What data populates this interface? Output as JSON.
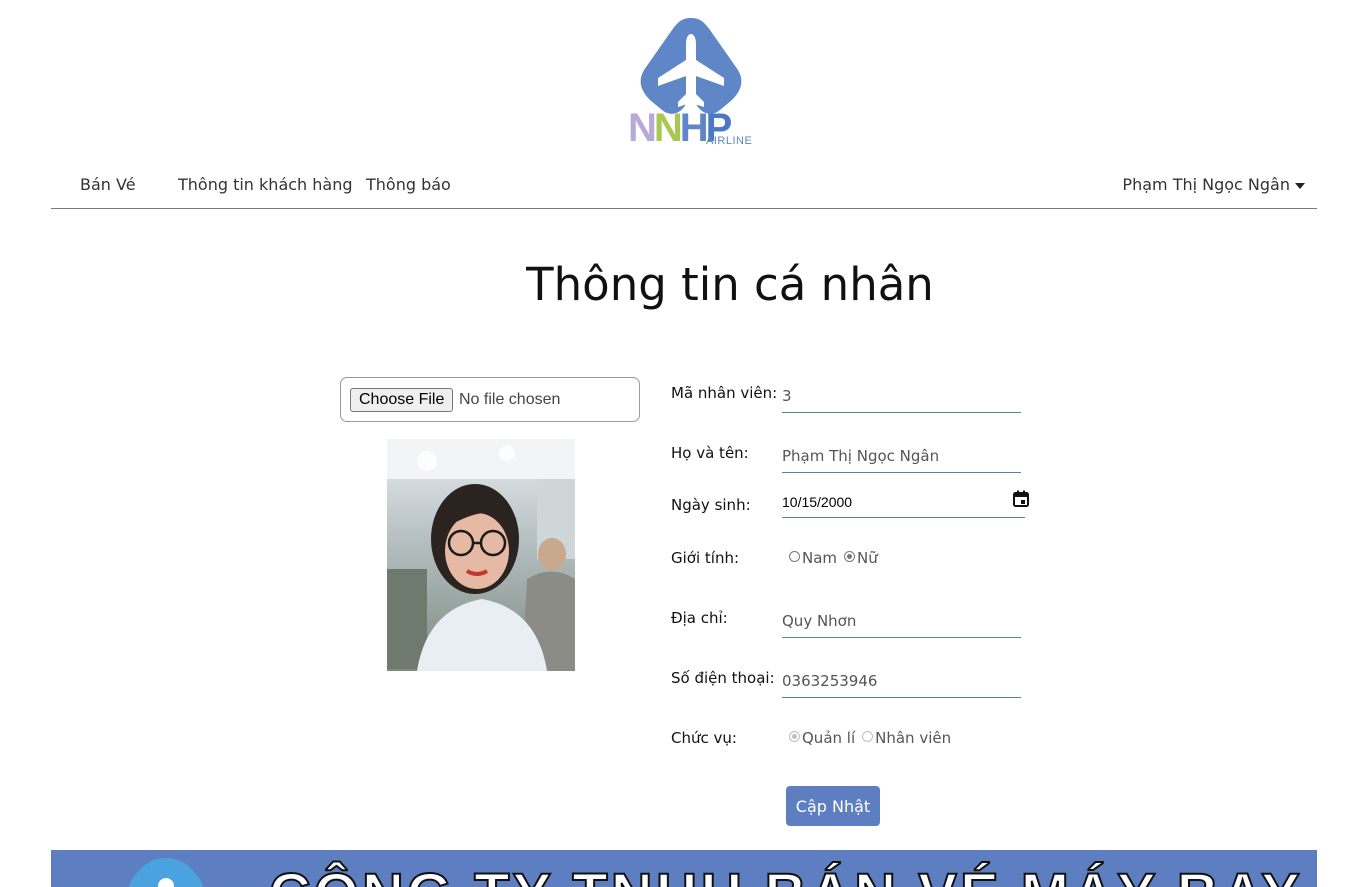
{
  "logo": {
    "brand": "NNHP",
    "sub": "AIRLINE",
    "colors": {
      "plane": "#5f86c7",
      "n1": "#b7a9d9",
      "n2": "#a7c954",
      "h": "#5f86c7",
      "p": "#4c77c2"
    }
  },
  "nav": {
    "items": [
      "Bán Vé",
      "Thông tin khách hàng",
      "Thông báo"
    ],
    "user": "Phạm Thị Ngọc Ngân"
  },
  "page": {
    "title": "Thông tin cá nhân"
  },
  "upload": {
    "button": "Choose File",
    "status": "No file chosen"
  },
  "form": {
    "employee_id": {
      "label": "Mã nhân viên:",
      "value": "3"
    },
    "full_name": {
      "label": "Họ và tên:",
      "value": "Phạm Thị Ngọc Ngân"
    },
    "birthday": {
      "label": "Ngày sinh:",
      "value": "10/15/2000"
    },
    "gender": {
      "label": "Giới tính:",
      "options": [
        "Nam",
        "Nữ"
      ],
      "selected": "Nữ"
    },
    "address": {
      "label": "Địa chỉ:",
      "value": "Quy Nhơn"
    },
    "phone": {
      "label": "Số điện thoại:",
      "value": "0363253946"
    },
    "position": {
      "label": "Chức vụ:",
      "options": [
        "Quản lí",
        "Nhân viên"
      ],
      "selected": "Quản lí"
    },
    "submit": "Cập Nhật"
  },
  "banner": {
    "text": "CÔNG TY TNHH BÁN VÉ MÁY BAY",
    "color": "#5d7fc1"
  },
  "accent": "#5d7fc1"
}
